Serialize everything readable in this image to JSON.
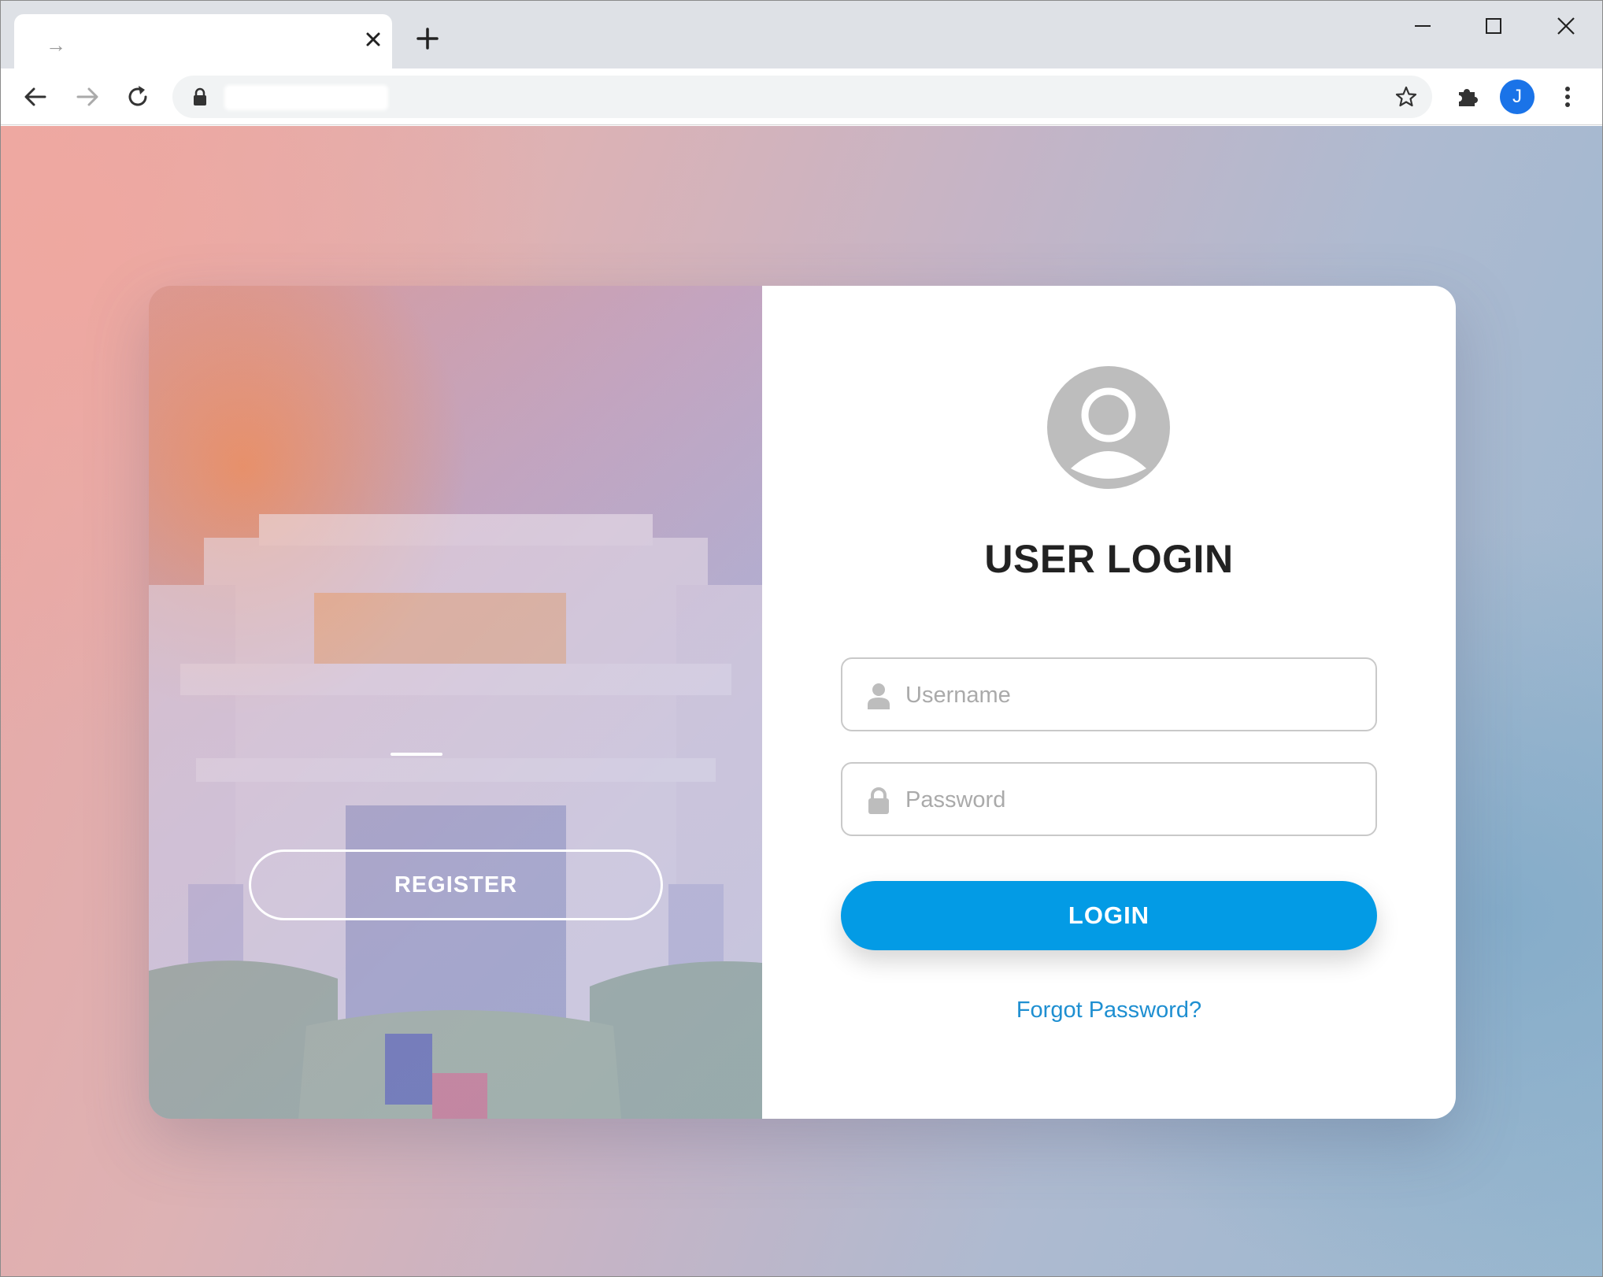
{
  "browser": {
    "tab": {
      "title": "→"
    },
    "new_tab_label": "+",
    "profile_initial": "J",
    "icons": [
      "back-arrow-icon",
      "forward-arrow-icon",
      "reload-icon",
      "lock-icon",
      "star-icon",
      "puzzle-icon",
      "kebab-menu-icon",
      "minimize-icon",
      "maximize-icon",
      "close-icon"
    ]
  },
  "left_panel": {
    "register_label": "REGISTER"
  },
  "login_form": {
    "heading": "USER LOGIN",
    "username_placeholder": "Username",
    "password_placeholder": "Password",
    "login_label": "LOGIN",
    "forgot_label": "Forgot Password?"
  },
  "colors": {
    "primary": "#039be5",
    "link": "#1e8fd1",
    "avatar_gray": "#bdbdbd",
    "profile_badge": "#1a73e8"
  }
}
